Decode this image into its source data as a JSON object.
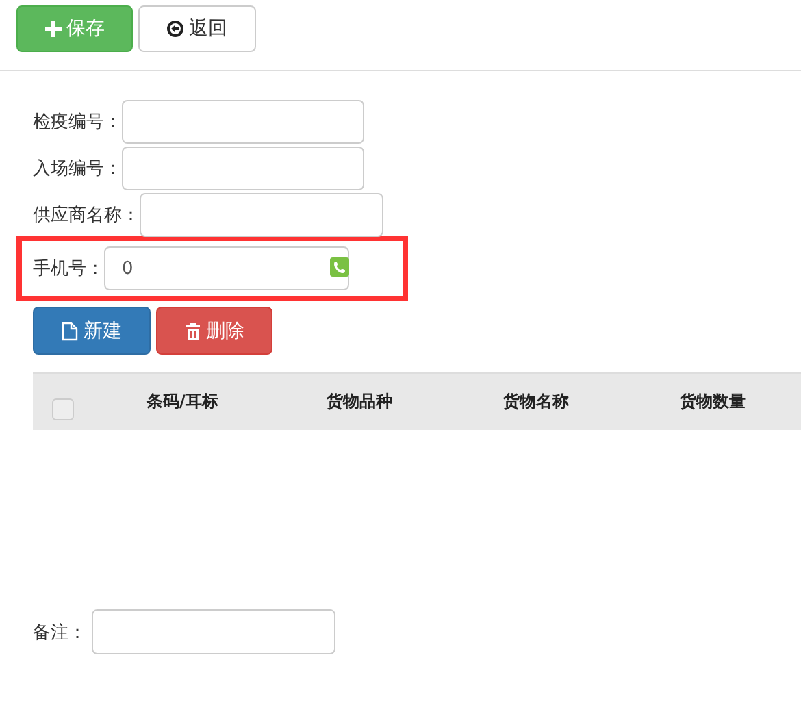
{
  "toolbar": [
    {
      "kind": "save",
      "label": "保存"
    },
    {
      "kind": "back",
      "label": "返回"
    }
  ],
  "fields": [
    {
      "label": "检疫编号：",
      "highlighted": false,
      "phone_icon": false
    },
    {
      "label": "入场编号：",
      "highlighted": false,
      "phone_icon": false
    },
    {
      "label": "供应商名称：",
      "highlighted": false,
      "phone_icon": false
    },
    {
      "label": "手机号：",
      "value": "0",
      "highlighted": true,
      "phone_icon": true
    }
  ],
  "actions": [
    {
      "kind": "new",
      "label": "新建"
    },
    {
      "kind": "delete",
      "label": "删除"
    }
  ],
  "table": {
    "select_all_checked": false,
    "columns": [
      "条码/耳标",
      "货物品种",
      "货物名称",
      "货物数量"
    ]
  },
  "remarks": {
    "label": "备注："
  }
}
